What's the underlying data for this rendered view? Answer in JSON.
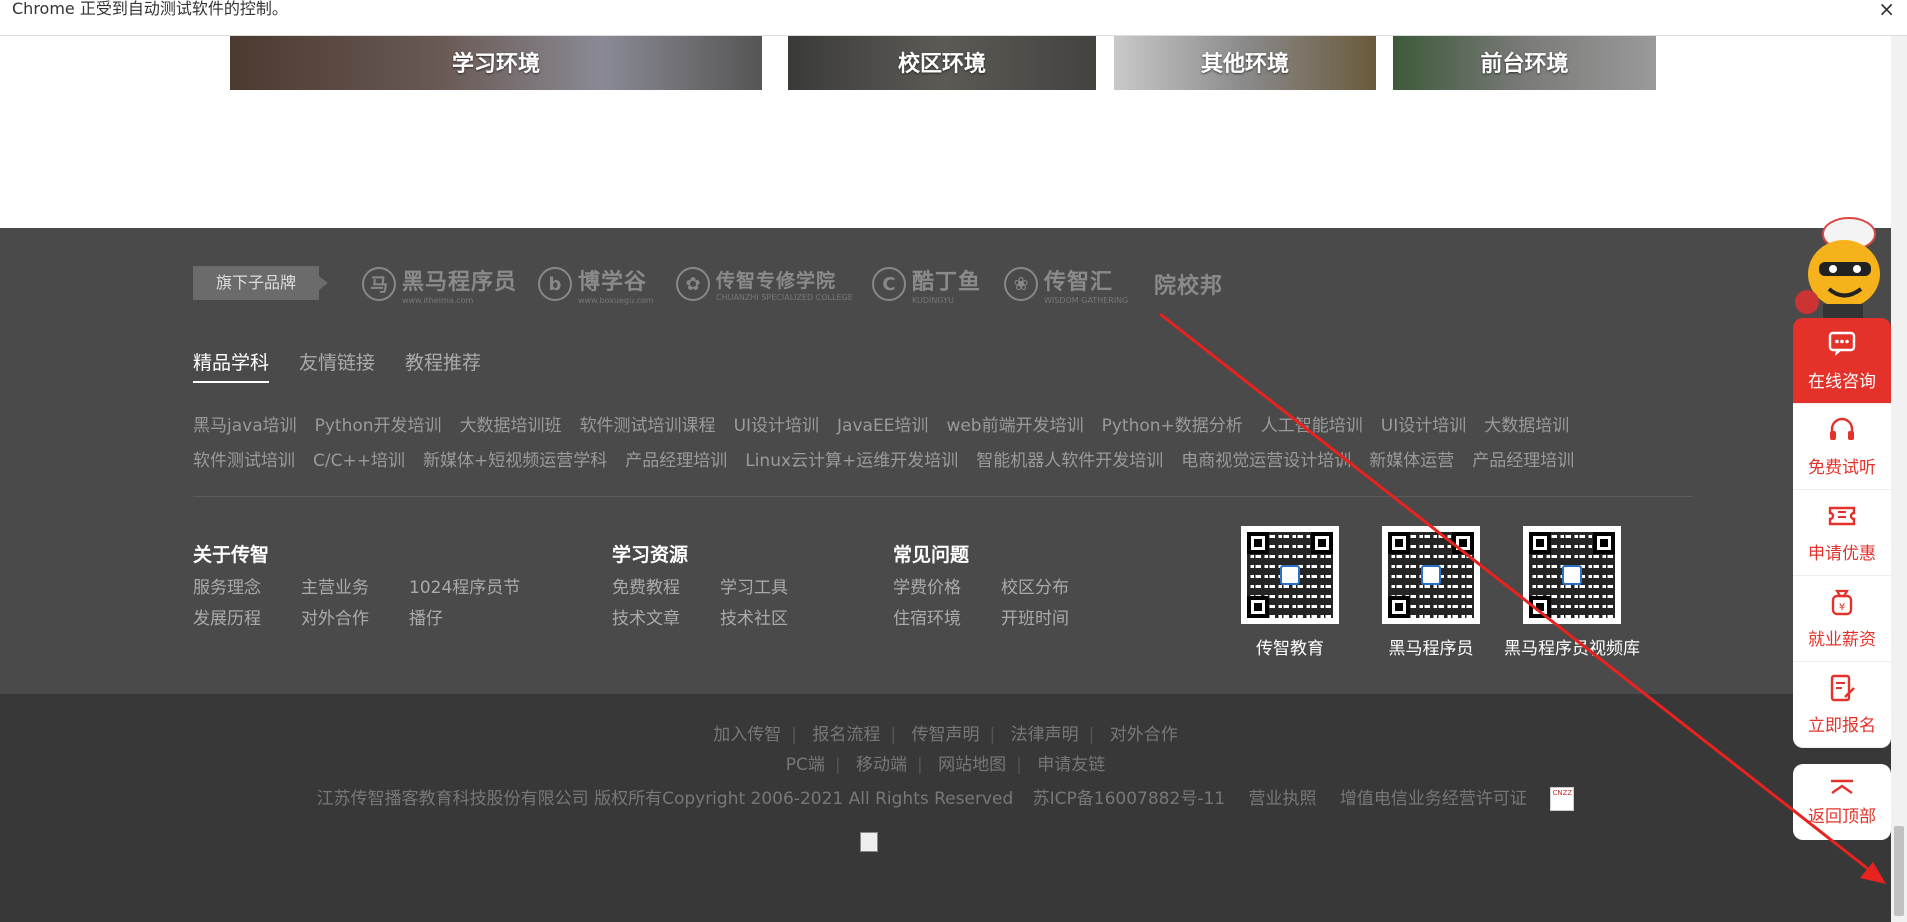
{
  "infobar": {
    "message": "Chrome 正受到自动测试软件的控制。",
    "close": "×"
  },
  "environments": [
    {
      "label": "学习环境"
    },
    {
      "label": "校区环境"
    },
    {
      "label": "其他环境"
    },
    {
      "label": "前台环境"
    }
  ],
  "brands": {
    "tag": "旗下子品牌",
    "items": [
      {
        "name": "黑马程序员",
        "sub": "www.itheima.com",
        "icon": "horse-logo-icon"
      },
      {
        "name": "博学谷",
        "sub": "www.boxuegu.com",
        "icon": "boxuegu-logo-icon"
      },
      {
        "name": "传智专修学院",
        "sub": "CHUANZHI SPECIALIZED COLLEGE",
        "icon": "college-seal-icon"
      },
      {
        "name": "酷丁鱼",
        "sub": "KUDINGYU",
        "icon": "kudingyu-logo-icon"
      },
      {
        "name": "传智汇",
        "sub": "WISDOM GATHERING",
        "icon": "flower-logo-icon"
      },
      {
        "name": "院校邦",
        "sub": "",
        "icon": "yuanxiaobang-logo-icon"
      }
    ]
  },
  "tabs": [
    {
      "label": "精品学科",
      "active": true
    },
    {
      "label": "友情链接",
      "active": false
    },
    {
      "label": "教程推荐",
      "active": false
    }
  ],
  "course_links": {
    "row1": [
      "黑马java培训",
      "Python开发培训",
      "大数据培训班",
      "软件测试培训课程",
      "UI设计培训",
      "JavaEE培训",
      "web前端开发培训",
      "Python+数据分析",
      "人工智能培训",
      "UI设计培训",
      "大数据培训"
    ],
    "row2": [
      "软件测试培训",
      "C/C++培训",
      "新媒体+短视频运营学科",
      "产品经理培训",
      "Linux云计算+运维开发培训",
      "智能机器人软件开发培训",
      "电商视觉运营设计培训",
      "新媒体运营",
      "产品经理培训"
    ]
  },
  "columns": {
    "about": {
      "title": "关于传智",
      "links": [
        "服务理念",
        "主营业务",
        "1024程序员节",
        "发展历程",
        "对外合作",
        "播仔"
      ]
    },
    "resources": {
      "title": "学习资源",
      "links": [
        "免费教程",
        "学习工具",
        "技术文章",
        "技术社区"
      ]
    },
    "faq": {
      "title": "常见问题",
      "links": [
        "学费价格",
        "校区分布",
        "住宿环境",
        "开班时间"
      ]
    }
  },
  "qrcodes": [
    {
      "caption": "传智教育"
    },
    {
      "caption": "黑马程序员"
    },
    {
      "caption": "黑马程序员视频库"
    }
  ],
  "bottom": {
    "row1": [
      "加入传智",
      "报名流程",
      "传智声明",
      "法律声明",
      "对外合作"
    ],
    "row2": [
      "PC端",
      "移动端",
      "网站地图",
      "申请友链"
    ],
    "copyright": "江苏传智播客教育科技股份有限公司 版权所有Copyright 2006-2021  All Rights Reserved",
    "icp": "苏ICP备16007882号-11",
    "license": "营业执照",
    "telecom": "增值电信业务经营许可证",
    "cnzz": "CNZZ"
  },
  "sidebar": {
    "items": [
      {
        "label": "在线咨询",
        "icon": "chat-bubble-icon"
      },
      {
        "label": "免费试听",
        "icon": "headset-icon"
      },
      {
        "label": "申请优惠",
        "icon": "ticket-icon"
      },
      {
        "label": "就业薪资",
        "icon": "money-bag-icon"
      },
      {
        "label": "立即报名",
        "icon": "form-edit-icon"
      }
    ],
    "back_top": "返回顶部"
  },
  "colors": {
    "accent": "#e4322b",
    "footer": "#4a4a4a",
    "footer_bottom": "#383838"
  }
}
